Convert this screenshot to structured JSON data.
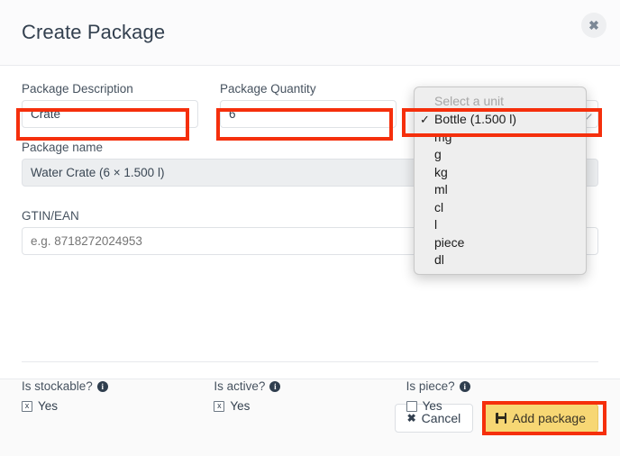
{
  "dialog": {
    "title": "Create Package",
    "close_icon": "close-icon"
  },
  "form": {
    "package_description": {
      "label": "Package Description",
      "value": "Crate"
    },
    "package_quantity": {
      "label": "Package Quantity",
      "value": "6"
    },
    "package_unit": {
      "label": "",
      "placeholder": "Select a unit",
      "selected": "Bottle (1.500 l)"
    },
    "package_name": {
      "label": "Package name",
      "value": "Water Crate (6 × 1.500 l)"
    },
    "gtin_ean": {
      "label": "GTIN/EAN",
      "placeholder": "e.g. 8718272024953",
      "value": ""
    }
  },
  "unit_dropdown": {
    "placeholder": "Select a unit",
    "options": [
      {
        "label": "Bottle (1.500 l)",
        "selected": true
      },
      {
        "label": "mg",
        "selected": false
      },
      {
        "label": "g",
        "selected": false
      },
      {
        "label": "kg",
        "selected": false
      },
      {
        "label": "ml",
        "selected": false
      },
      {
        "label": "cl",
        "selected": false
      },
      {
        "label": "l",
        "selected": false
      },
      {
        "label": "piece",
        "selected": false
      },
      {
        "label": "dl",
        "selected": false
      }
    ],
    "check_glyph": "✓"
  },
  "options": [
    {
      "question": "Is stockable?",
      "info_icon": "info-icon",
      "choice_label": "Yes",
      "checked": true,
      "check_glyph": "x"
    },
    {
      "question": "Is active?",
      "info_icon": "info-icon",
      "choice_label": "Yes",
      "checked": true,
      "check_glyph": "x"
    },
    {
      "question": "Is piece?",
      "info_icon": "info-icon",
      "choice_label": "Yes",
      "checked": false,
      "check_glyph": ""
    }
  ],
  "footer": {
    "cancel_label": "Cancel",
    "cancel_icon": "close-x-icon",
    "add_label": "Add package",
    "add_icon": "save-floppy-icon"
  },
  "annotations": {
    "accent_color": "#f52f0c",
    "highlight_targets": [
      "package-description-input",
      "package-quantity-input",
      "unit-dropdown-selected-option",
      "add-package-button"
    ]
  },
  "info_glyph": "i"
}
